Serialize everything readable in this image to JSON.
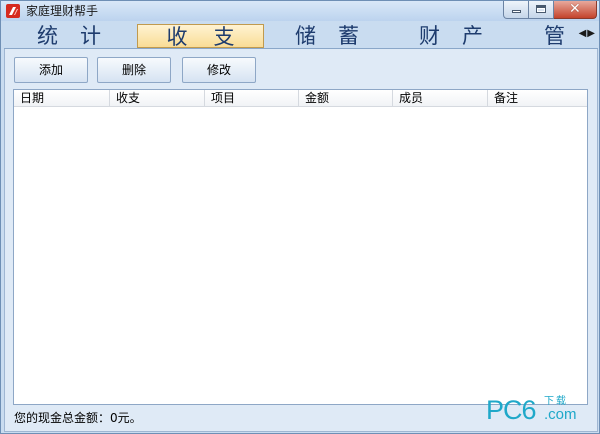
{
  "window": {
    "title": "家庭理财帮手"
  },
  "tabs": [
    {
      "label": "统计",
      "active": false
    },
    {
      "label": "收支",
      "active": true
    },
    {
      "label": "储蓄",
      "active": false
    },
    {
      "label": "财产",
      "active": false
    },
    {
      "label": "管",
      "active": false
    }
  ],
  "tab_scroll": {
    "left_icon": "arrow-left-icon",
    "right_icon": "arrow-right-icon"
  },
  "toolbar": {
    "add_label": "添加",
    "delete_label": "删除",
    "edit_label": "修改"
  },
  "table": {
    "columns": [
      "日期",
      "收支",
      "项目",
      "金额",
      "成员",
      "备注"
    ],
    "rows": []
  },
  "status": {
    "cash_total": "您的现金总金额：0元。"
  },
  "watermark": {
    "main": "PC6",
    "small": "下载",
    "domain": ".com"
  },
  "colors": {
    "window_bg": "#c9dcf0",
    "active_tab": "#f9dc96",
    "tab_text": "#1e3c6e",
    "watermark": "#1fa8c9"
  }
}
